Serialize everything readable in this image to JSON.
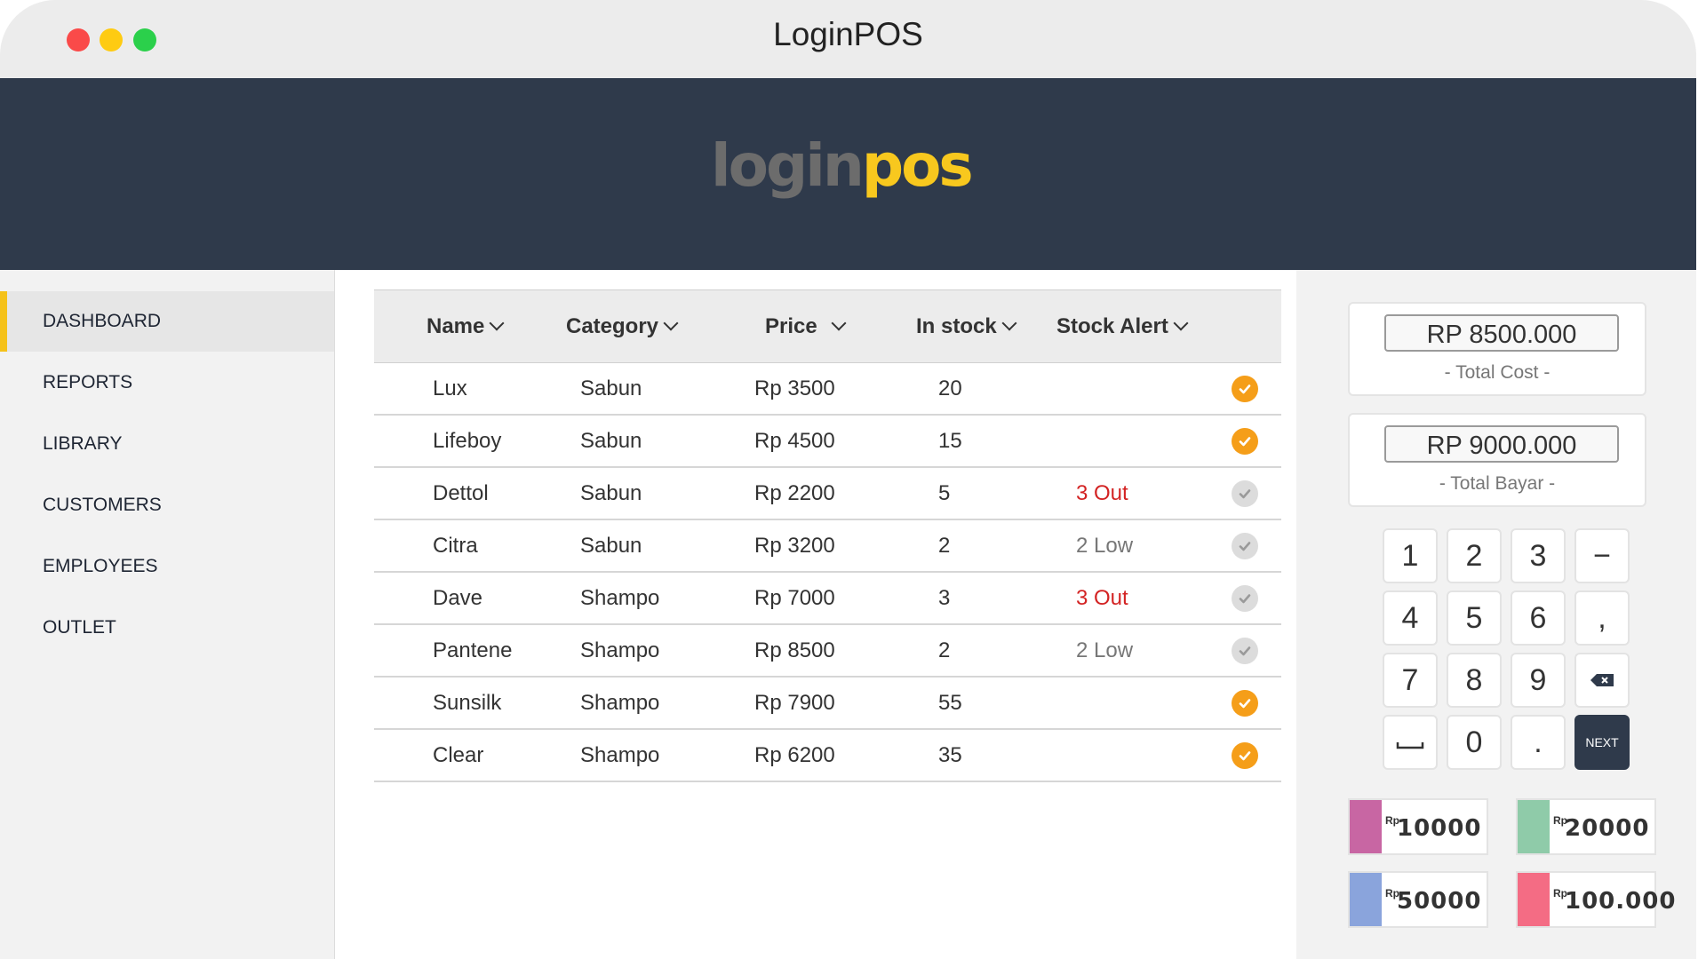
{
  "window": {
    "title": "LoginPOS"
  },
  "header": {
    "logo_part1": "login",
    "logo_part2": "pos"
  },
  "sidebar": {
    "items": [
      {
        "label": "DASHBOARD",
        "active": true
      },
      {
        "label": "REPORTS"
      },
      {
        "label": "LIBRARY"
      },
      {
        "label": "CUSTOMERS"
      },
      {
        "label": "EMPLOYEES"
      },
      {
        "label": "OUTLET"
      }
    ]
  },
  "table": {
    "columns": [
      "Name",
      "Category",
      "Price",
      "In stock",
      "Stock Alert"
    ],
    "rows": [
      {
        "name": "Lux",
        "category": "Sabun",
        "price": "Rp 3500",
        "stock": "20",
        "alert": "",
        "alert_type": "",
        "ok": true
      },
      {
        "name": "Lifeboy",
        "category": "Sabun",
        "price": "Rp 4500",
        "stock": "15",
        "alert": "",
        "alert_type": "",
        "ok": true
      },
      {
        "name": "Dettol",
        "category": "Sabun",
        "price": "Rp 2200",
        "stock": "5",
        "alert": "3 Out",
        "alert_type": "out",
        "ok": false
      },
      {
        "name": "Citra",
        "category": "Sabun",
        "price": "Rp 3200",
        "stock": "2",
        "alert": "2 Low",
        "alert_type": "low",
        "ok": false
      },
      {
        "name": "Dave",
        "category": "Shampo",
        "price": "Rp 7000",
        "stock": "3",
        "alert": "3 Out",
        "alert_type": "out",
        "ok": false
      },
      {
        "name": "Pantene",
        "category": "Shampo",
        "price": "Rp 8500",
        "stock": "2",
        "alert": "2 Low",
        "alert_type": "low",
        "ok": false
      },
      {
        "name": "Sunsilk",
        "category": "Shampo",
        "price": "Rp 7900",
        "stock": "55",
        "alert": "",
        "alert_type": "",
        "ok": true
      },
      {
        "name": "Clear",
        "category": "Shampo",
        "price": "Rp 6200",
        "stock": "35",
        "alert": "",
        "alert_type": "",
        "ok": true
      }
    ]
  },
  "totals": {
    "total_cost_value": "RP 8500.000",
    "total_cost_label": "- Total Cost -",
    "total_bayar_value": "RP 9000.000",
    "total_bayar_label": "- Total Bayar -"
  },
  "keypad": {
    "keys": [
      "1",
      "2",
      "3",
      "−",
      "4",
      "5",
      "6",
      ",",
      "7",
      "8",
      "9",
      "backspace",
      "space",
      "0",
      ".",
      "NEXT"
    ]
  },
  "quick_cash": {
    "currency_symbol": "Rp",
    "notes": [
      {
        "amount": "10000",
        "color": "#c866a3"
      },
      {
        "amount": "20000",
        "color": "#8fcba9"
      },
      {
        "amount": "50000",
        "color": "#8aa4dc"
      },
      {
        "amount": "100.000",
        "color": "#f46c84"
      }
    ]
  },
  "colors": {
    "header_bg": "#2f3a4b",
    "accent_yellow": "#f5c21a",
    "check_orange": "#f59e19",
    "alert_red": "#d32323"
  }
}
